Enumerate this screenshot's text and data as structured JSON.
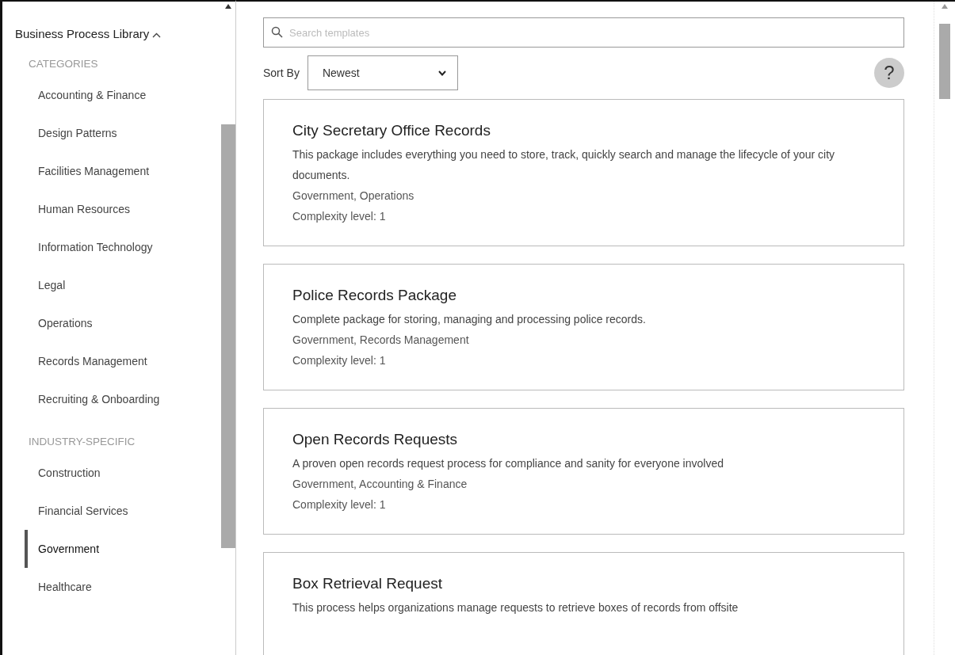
{
  "sidebar": {
    "title": "Business Process Library",
    "sections": [
      {
        "heading": "CATEGORIES",
        "items": [
          {
            "label": "Accounting & Finance",
            "selected": false
          },
          {
            "label": "Design Patterns",
            "selected": false
          },
          {
            "label": "Facilities Management",
            "selected": false
          },
          {
            "label": "Human Resources",
            "selected": false
          },
          {
            "label": "Information Technology",
            "selected": false
          },
          {
            "label": "Legal",
            "selected": false
          },
          {
            "label": "Operations",
            "selected": false
          },
          {
            "label": "Records Management",
            "selected": false
          },
          {
            "label": "Recruiting & Onboarding",
            "selected": false
          }
        ]
      },
      {
        "heading": "INDUSTRY-SPECIFIC",
        "items": [
          {
            "label": "Construction",
            "selected": false
          },
          {
            "label": "Financial Services",
            "selected": false
          },
          {
            "label": "Government",
            "selected": true
          },
          {
            "label": "Healthcare",
            "selected": false
          }
        ]
      }
    ]
  },
  "search": {
    "placeholder": "Search templates"
  },
  "sort": {
    "label": "Sort By",
    "value": "Newest"
  },
  "help": {
    "label": "?"
  },
  "cards": [
    {
      "title": "City Secretary Office Records",
      "description": "This package includes everything you need to store, track, quickly search and manage the lifecycle of your city documents.",
      "tags": "Government, Operations",
      "complexity": "Complexity level: 1"
    },
    {
      "title": "Police Records Package",
      "description": "Complete package for storing, managing and processing police records.",
      "tags": "Government, Records Management",
      "complexity": "Complexity level: 1"
    },
    {
      "title": "Open Records Requests",
      "description": "A proven open records request process for compliance and sanity for everyone involved",
      "tags": "Government, Accounting & Finance",
      "complexity": "Complexity level: 1"
    },
    {
      "title": "Box Retrieval Request",
      "description": "This process helps organizations manage requests to retrieve boxes of records from offsite"
    }
  ]
}
